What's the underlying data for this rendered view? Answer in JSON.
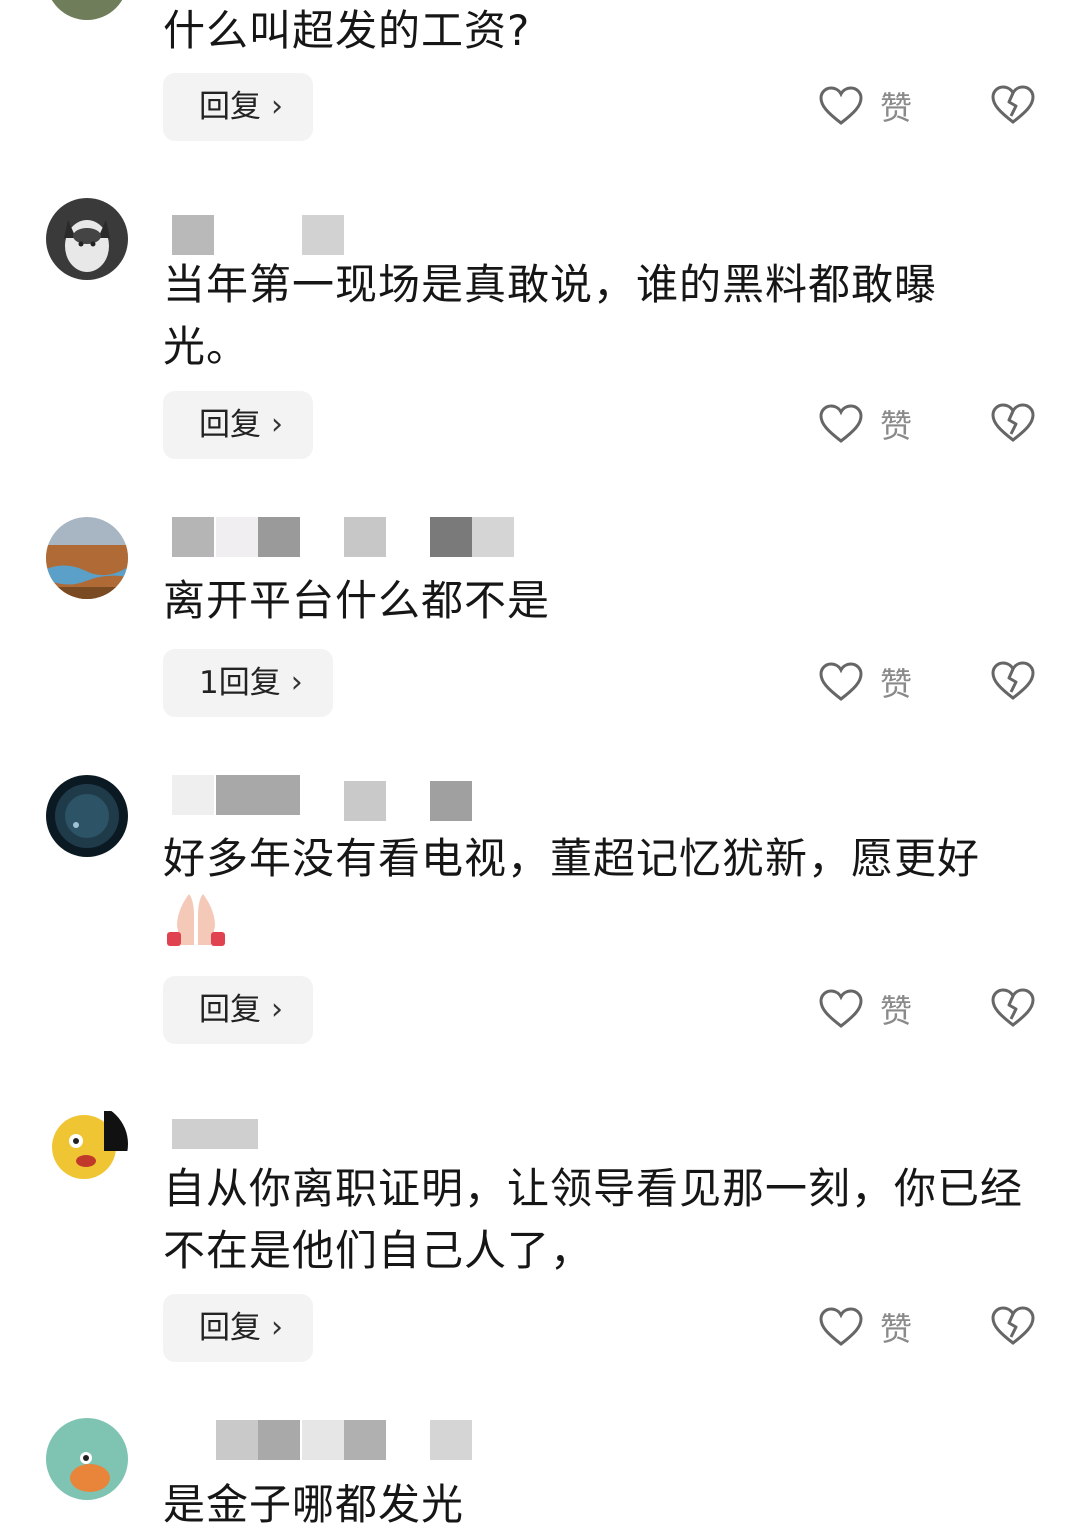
{
  "comments": [
    {
      "text": "什么叫超发的工资?",
      "reply_label": "回复",
      "like_label": "赞"
    },
    {
      "text": "当年第一现场是真敢说，谁的黑料都敢曝光。",
      "reply_label": "回复",
      "like_label": "赞"
    },
    {
      "text": "离开平台什么都不是",
      "reply_label": "1回复",
      "like_label": "赞"
    },
    {
      "text": "好多年没有看电视，董超记忆犹新，愿更好",
      "reply_label": "回复",
      "like_label": "赞"
    },
    {
      "text": "自从你离职证明，让领导看见那一刻，你已经不在是他们自己人了，",
      "reply_label": "回复",
      "like_label": "赞"
    },
    {
      "text": "是金子哪都发光"
    }
  ],
  "icons": {
    "reply_chevron": "chevron-right-icon",
    "like": "heart-outline-icon",
    "dislike": "broken-heart-icon",
    "emoji": "folded-hands-emoji"
  },
  "colors": {
    "reply_bg": "#f3f3f3",
    "icon_gray": "#666666",
    "label_gray": "#8a8a8a"
  }
}
